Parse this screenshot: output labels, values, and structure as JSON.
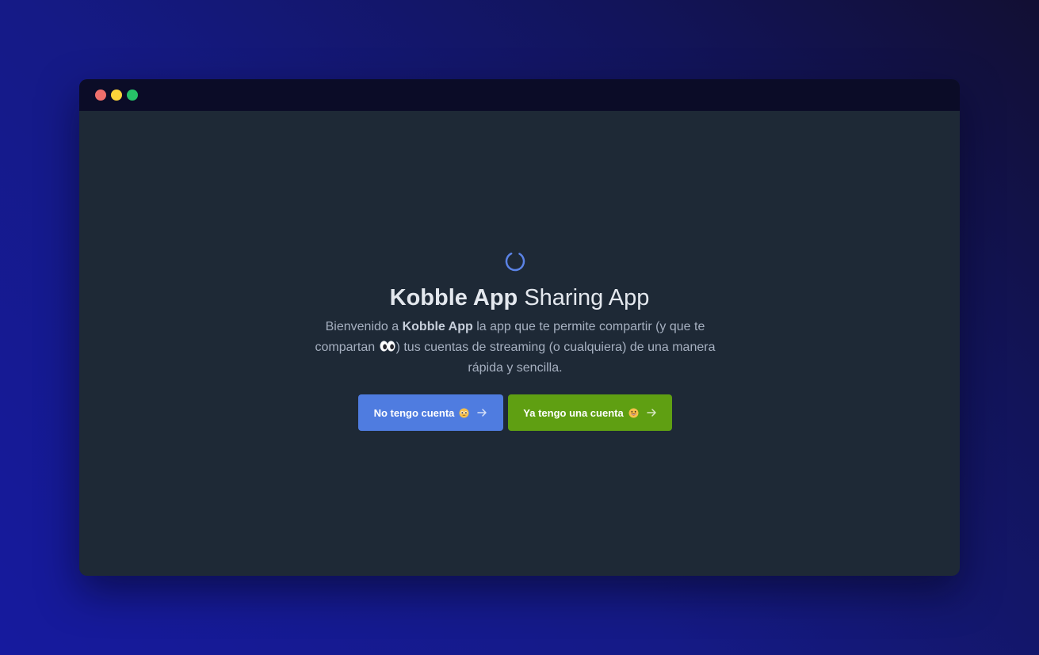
{
  "window": {
    "controls": [
      "close",
      "minimize",
      "maximize"
    ]
  },
  "hero": {
    "title_strong": "Kobble App",
    "title_rest": " Sharing App",
    "desc_prefix": "Bienvenido a ",
    "desc_strong": "Kobble App",
    "desc_mid": " la app que te permite compartir (y que te compartan ",
    "desc_emoji": "eyes-icon",
    "desc_suffix": ") tus cuentas de streaming (o cualquiera) de una manera rápida y sencilla."
  },
  "buttons": {
    "no_account_label": "No tengo cuenta",
    "no_account_emoji": "pleading-face-icon",
    "have_account_label": "Ya tengo una cuenta",
    "have_account_emoji": "grinning-face-icon",
    "arrow_icon": "arrow-right-icon"
  },
  "colors": {
    "accent_blue": "#4f7ce0",
    "accent_green": "#5f9f12",
    "spinner": "#5b83e6",
    "window_bg": "#1e2936",
    "titlebar_bg": "#0b0c27"
  },
  "icons": {
    "loader": "spinner-icon"
  }
}
